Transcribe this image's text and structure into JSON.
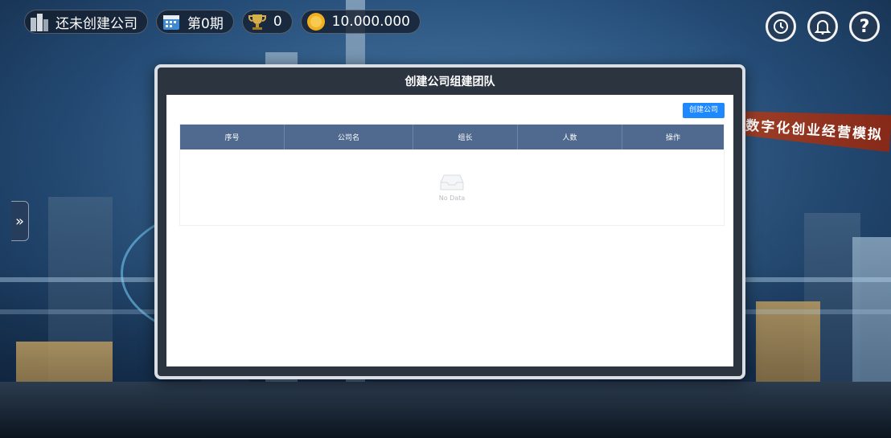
{
  "topbar": {
    "company_status": "还未创建公司",
    "period": "第0期",
    "trophies": "0",
    "coins": "10.000.000"
  },
  "banner": {
    "text": "数字化创业经营模拟"
  },
  "modal": {
    "title": "创建公司组建团队",
    "create_button": "创建公司",
    "table": {
      "headers": [
        "序号",
        "公司名",
        "组长",
        "人数",
        "操作"
      ],
      "rows": [],
      "empty_text": "No Data"
    }
  },
  "colors": {
    "accent": "#1e88ff",
    "table_header": "#4f6a8e",
    "modal_frame": "#2c3440"
  },
  "icons": [
    "buildings-icon",
    "calendar-icon",
    "trophy-icon",
    "coin-icon",
    "history-icon",
    "bell-icon",
    "help-icon",
    "double-chevron-right-icon",
    "empty-inbox-icon"
  ]
}
